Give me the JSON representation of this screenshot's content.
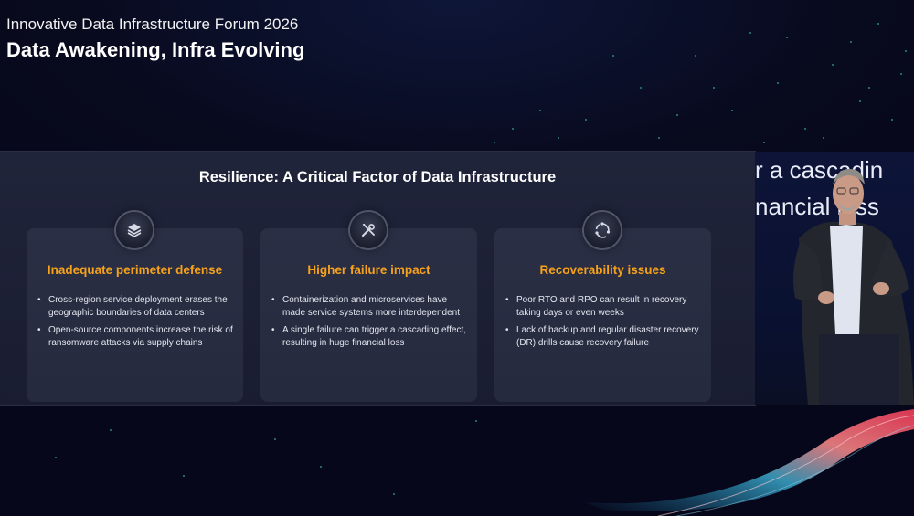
{
  "event": {
    "title": "Innovative Data Infrastructure Forum 2026",
    "subtitle": "Data Awakening, Infra Evolving"
  },
  "slide": {
    "title": "Resilience: A Critical Factor of Data Infrastructure",
    "accent_color": "#f6a21a",
    "cards": [
      {
        "icon": "stack-layers-icon",
        "heading": "Inadequate perimeter defense",
        "bullets": [
          "Cross-region service deployment erases the geographic boundaries of data centers",
          "Open-source components increase the risk of ransomware attacks via supply chains"
        ]
      },
      {
        "icon": "wrench-screwdriver-icon",
        "heading": "Higher failure impact",
        "bullets": [
          "Containerization and microservices have made service systems more interdependent",
          "A single failure can trigger a cascading effect, resulting in huge financial loss"
        ]
      },
      {
        "icon": "recovery-cycle-icon",
        "heading": "Recoverability issues",
        "bullets": [
          "Poor RTO and RPO can result in recovery taking days or even weeks",
          "Lack of backup and regular disaster recovery (DR) drills cause recovery failure"
        ]
      }
    ]
  },
  "background_screen": {
    "line1": "r a cascadin",
    "line2": "nancial loss"
  }
}
